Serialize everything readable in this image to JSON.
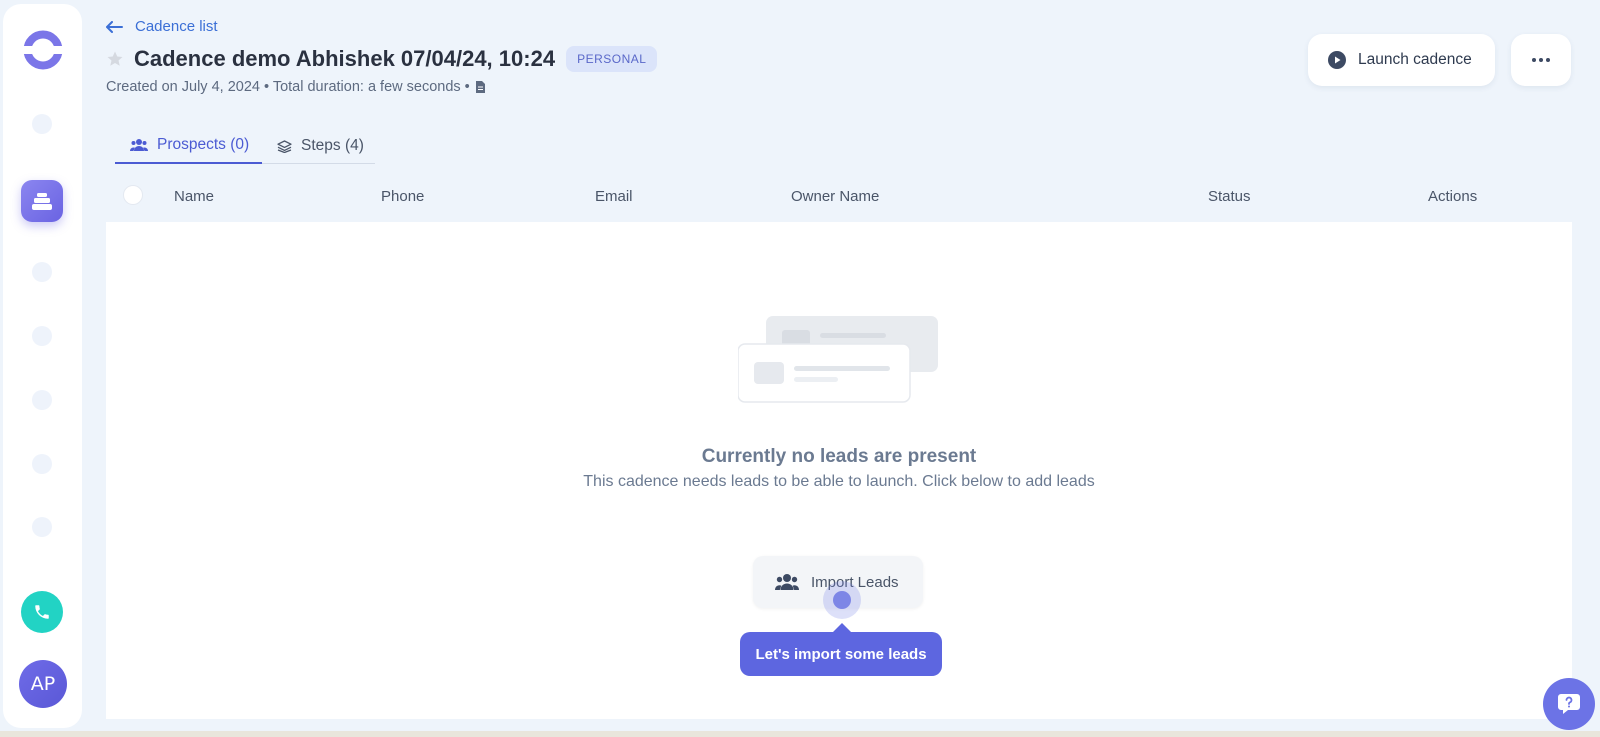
{
  "breadcrumb": {
    "back_label": "Cadence list"
  },
  "header": {
    "title": "Cadence demo Abhishek 07/04/24, 10:24",
    "badge": "PERSONAL",
    "meta": "Created on July 4, 2024 • Total duration: a few seconds •"
  },
  "actions": {
    "launch_label": "Launch cadence"
  },
  "tabs": [
    {
      "label": "Prospects (0)",
      "active": true,
      "icon": "users-icon"
    },
    {
      "label": "Steps (4)",
      "active": false,
      "icon": "layers-icon"
    }
  ],
  "table": {
    "columns": [
      "Name",
      "Phone",
      "Email",
      "Owner Name",
      "Status",
      "Actions"
    ]
  },
  "empty_state": {
    "title": "Currently no leads are present",
    "subtitle": "This cadence needs leads to be able to launch. Click below to add leads",
    "import_label": "Import Leads",
    "tooltip": "Let's import some leads"
  },
  "user": {
    "initials": "AP"
  },
  "colors": {
    "accent": "#4b5bd3",
    "tooltip": "#5d66e0",
    "phone": "#22d3c4"
  }
}
